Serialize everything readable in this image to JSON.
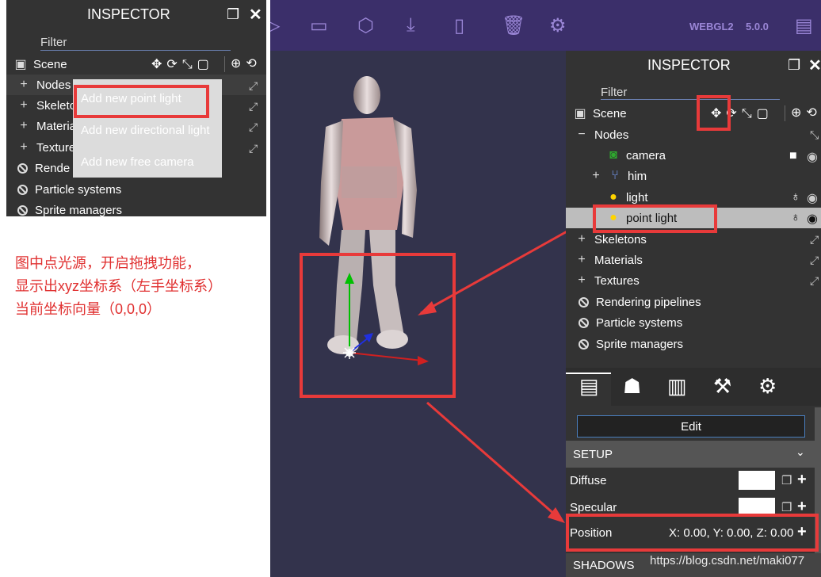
{
  "left_inspector": {
    "title": "INSPECTOR",
    "filter_label": "Filter",
    "scene_label": "Scene",
    "items": [
      {
        "label": "Nodes"
      },
      {
        "label": "Skeleto"
      },
      {
        "label": "Materia"
      },
      {
        "label": "Texture"
      },
      {
        "label": "Rende"
      },
      {
        "label": "Particle systems"
      },
      {
        "label": "Sprite managers"
      }
    ],
    "context_menu": [
      "Add new point light",
      "Add new directional light",
      "Add new free camera"
    ]
  },
  "annotation": {
    "lines": [
      "图中点光源，开启拖拽功能，",
      "显示出xyz坐标系（左手坐标系）",
      "当前坐标向量（0,0,0）"
    ]
  },
  "toolbar": {
    "webgl_label": "WEBGL2",
    "version_label": "5.0.0"
  },
  "right_inspector": {
    "title": "INSPECTOR",
    "filter_label": "Filter",
    "scene_label": "Scene",
    "tree": [
      {
        "label": "Nodes"
      },
      {
        "label": "camera"
      },
      {
        "label": "him"
      },
      {
        "label": "light"
      },
      {
        "label": "point light"
      },
      {
        "label": "Skeletons"
      },
      {
        "label": "Materials"
      },
      {
        "label": "Textures"
      },
      {
        "label": "Rendering pipelines"
      },
      {
        "label": "Particle systems"
      },
      {
        "label": "Sprite managers"
      }
    ],
    "edit_button": "Edit",
    "setup_label": "SETUP",
    "diffuse_label": "Diffuse",
    "specular_label": "Specular",
    "position_label": "Position",
    "position_value": "X: 0.00, Y: 0.00, Z: 0.00",
    "shadows_label": "SHADOWS"
  },
  "watermark": "https://blog.csdn.net/maki077",
  "colors": {
    "panel_bg": "#333333",
    "toolbar_bg": "#3b2f6a",
    "viewport_bg": "#33334c",
    "highlight_red": "#e83a3a",
    "selected_row": "#bdbdbd"
  }
}
